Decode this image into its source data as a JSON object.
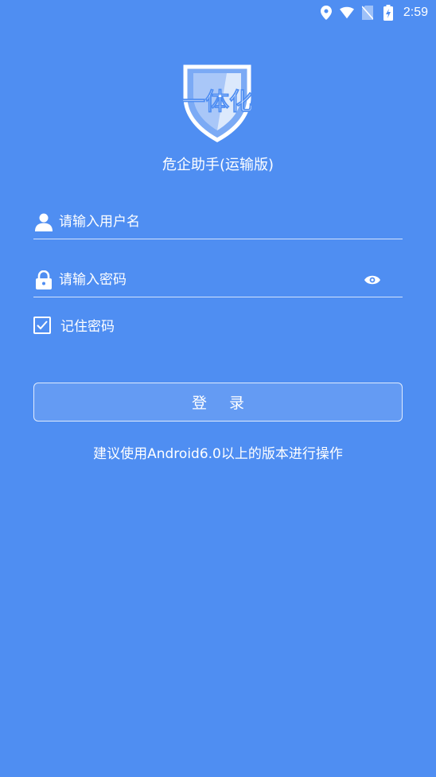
{
  "status_bar": {
    "time": "2:59",
    "icons": [
      "location-icon",
      "wifi-icon",
      "no-sim-icon",
      "battery-charging-icon"
    ]
  },
  "logo": {
    "text": "一体化"
  },
  "app": {
    "title": "危企助手(运输版)"
  },
  "form": {
    "username_placeholder": "请输入用户名",
    "username_value": "",
    "password_placeholder": "请输入密码",
    "password_value": "",
    "remember_label": "记住密码",
    "remember_checked": true
  },
  "login_button": {
    "label": "登录"
  },
  "hint": "建议使用Android6.0以上的版本进行操作",
  "colors": {
    "background": "#4f8ef2",
    "foreground": "#ffffff"
  }
}
